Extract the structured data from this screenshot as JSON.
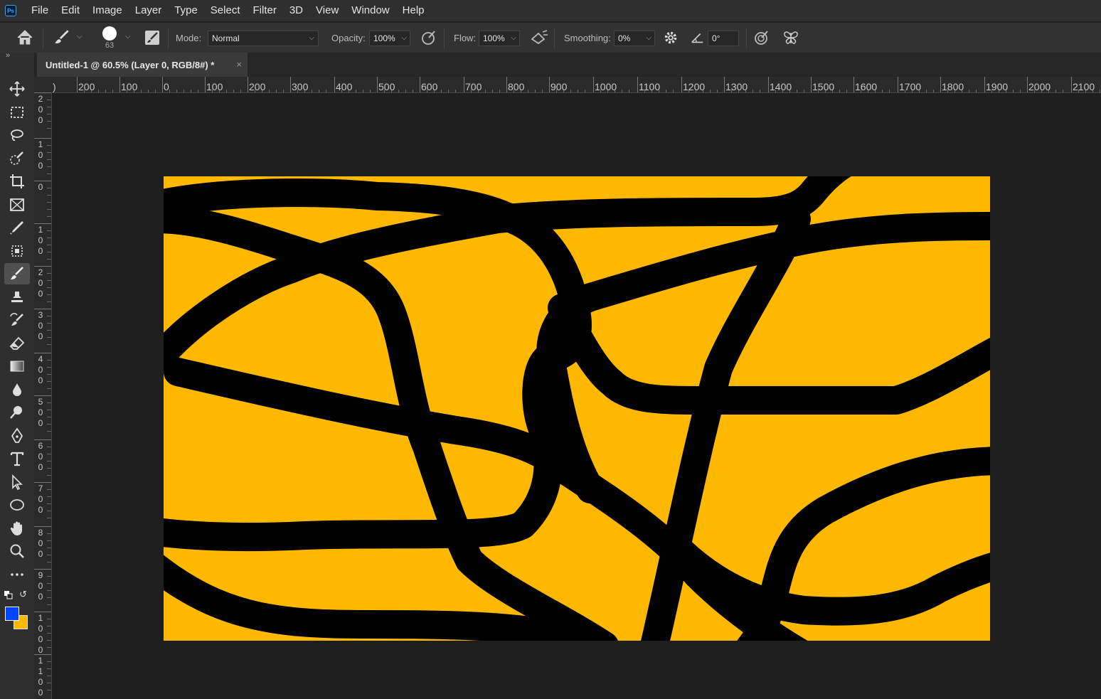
{
  "menu": [
    "File",
    "Edit",
    "Image",
    "Layer",
    "Type",
    "Select",
    "Filter",
    "3D",
    "View",
    "Window",
    "Help"
  ],
  "app_logo": "Ps",
  "options": {
    "brush_size": "63",
    "mode_label": "Mode:",
    "mode_value": "Normal",
    "opacity_label": "Opacity:",
    "opacity_value": "100%",
    "flow_label": "Flow:",
    "flow_value": "100%",
    "smoothing_label": "Smoothing:",
    "smoothing_value": "0%",
    "angle_value": "0°"
  },
  "document_tab": {
    "title": "Untitled-1 @ 60.5% (Layer 0, RGB/8#) *",
    "close": "×"
  },
  "ruler_top_labels": [
    ")",
    "200",
    "100",
    "0",
    "100",
    "200",
    "300",
    "400",
    "500",
    "600",
    "700",
    "800",
    "900",
    "1000",
    "1100",
    "1200",
    "1300",
    "1400",
    "1500",
    "1600",
    "1700",
    "1800",
    "1900",
    "2000",
    "2100"
  ],
  "ruler_left_labels": [
    "200",
    "100",
    "0",
    "100",
    "200",
    "300",
    "400",
    "500",
    "600",
    "700",
    "800",
    "900",
    "1000",
    "1100"
  ],
  "tools": [
    "move-tool",
    "marquee-tool",
    "lasso-tool",
    "quick-select-tool",
    "crop-tool",
    "frame-tool",
    "eyedropper-tool",
    "healing-brush-tool",
    "brush-tool",
    "clone-stamp-tool",
    "history-brush-tool",
    "eraser-tool",
    "gradient-tool",
    "blur-tool",
    "dodge-tool",
    "pen-tool",
    "type-tool",
    "path-select-tool",
    "ellipse-tool",
    "hand-tool",
    "zoom-tool",
    "more-tools"
  ],
  "colors": {
    "foreground": "#0044ff",
    "background": "#ffb800",
    "canvas_fill": "#ffb800",
    "stroke": "#000000"
  }
}
